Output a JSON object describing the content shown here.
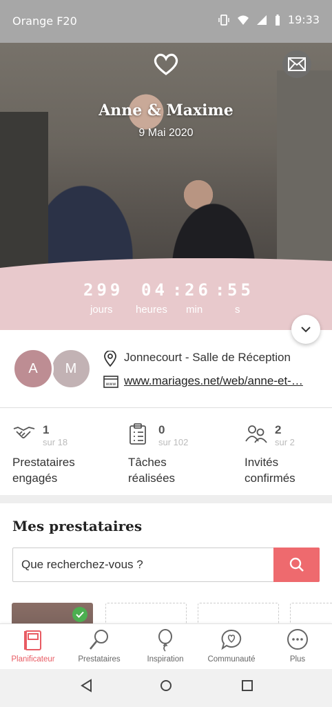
{
  "status_bar": {
    "carrier": "Orange F",
    "network": "20",
    "time": "19:33"
  },
  "hero": {
    "couple_name": "Anne & Maxime",
    "wedding_date": "9 Mai 2020",
    "countdown": {
      "days": "299",
      "hours": "04",
      "minutes": "26",
      "seconds": "55",
      "days_label": "jours",
      "hours_label": "heures",
      "minutes_label": "min",
      "seconds_label": "s",
      "separator": ":"
    },
    "colors": {
      "band": "#e8c9cc"
    }
  },
  "info": {
    "avatars": [
      "A",
      "M"
    ],
    "location": "Jonnecourt - Salle de Réception",
    "website": "www.mariages.net/web/anne-et-…"
  },
  "stats": [
    {
      "value": "1",
      "of": "sur 18",
      "label_line1": "Prestataires",
      "label_line2": "engagés",
      "icon": "handshake-icon"
    },
    {
      "value": "0",
      "of": "sur 102",
      "label_line1": "Tâches",
      "label_line2": "réalisées",
      "icon": "clipboard-icon"
    },
    {
      "value": "2",
      "of": "sur 2",
      "label_line1": "Invités",
      "label_line2": "confirmés",
      "icon": "guests-icon"
    }
  ],
  "vendors": {
    "title": "Mes prestataires",
    "search_placeholder": "Que recherchez-vous ?",
    "accent": "#ee6a6e"
  },
  "tabs": [
    {
      "label": "Planificateur",
      "icon": "planner-icon",
      "active": true
    },
    {
      "label": "Prestataires",
      "icon": "magnifier-icon",
      "active": false
    },
    {
      "label": "Inspiration",
      "icon": "balloon-icon",
      "active": false
    },
    {
      "label": "Communauté",
      "icon": "chat-heart-icon",
      "active": false
    },
    {
      "label": "Plus",
      "icon": "more-icon",
      "active": false
    }
  ]
}
